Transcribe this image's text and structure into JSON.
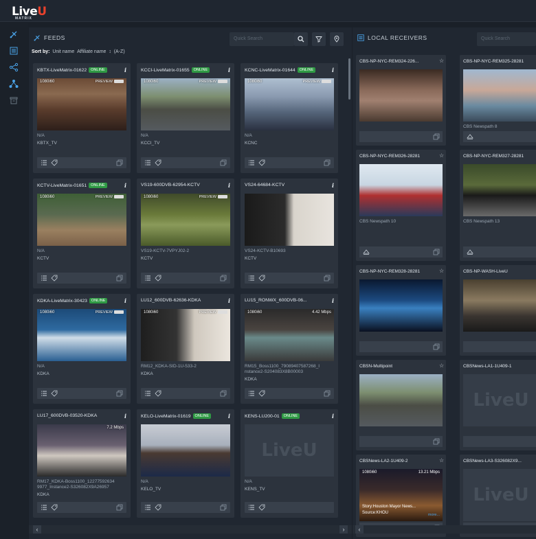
{
  "app": {
    "logo_main": "Live",
    "logo_accent": "U",
    "logo_sub": "MATRIX"
  },
  "nav": {
    "icons": [
      "satellite-icon",
      "list-icon",
      "share-icon",
      "network-icon",
      "archive-icon"
    ]
  },
  "feeds": {
    "title": "FEEDS",
    "search_placeholder": "Quick Search",
    "sort_label": "Sort by:",
    "sort_options": [
      "Unit name",
      "Affiliate name"
    ],
    "sort_order": "(A-Z)",
    "cards": [
      {
        "title": "KBTX-LiveMatrix-01622",
        "online": "ONLINE",
        "res": "1080i60",
        "preview": "PREVIEW",
        "line1": "N/A",
        "line2": "KBTX_TV",
        "scene": "interview"
      },
      {
        "title": "KCCI-LiveMatrix-01655",
        "online": "ONLINE",
        "res": "1080i60",
        "preview": "PREVIEW",
        "line1": "N/A",
        "line2": "KCCI_TV",
        "scene": "cycling"
      },
      {
        "title": "KCNC-LiveMatrix-01644",
        "online": "ONLINE",
        "res": "1080i60",
        "preview": "PREVIEW",
        "line1": "N/A",
        "line2": "KCNC",
        "scene": "snow"
      },
      {
        "title": "KCTV-LiveMatrix-01651",
        "online": "ONLINE",
        "res": "1080i60",
        "preview": "PREVIEW",
        "line1": "N/A",
        "line2": "KCTV",
        "scene": "baseball"
      },
      {
        "title": "VS19-600DVB-62954-KCTV",
        "online": "",
        "res": "1080i60",
        "preview": "PREVIEW",
        "line1": "VS19-KCTV-7VPYJ02-2",
        "line2": "KCTV",
        "scene": "helicopter"
      },
      {
        "title": "VS24-64684-KCTV",
        "online": "",
        "res": "",
        "preview": "",
        "line1": "VS24-KCTV-B10693",
        "line2": "KCTV",
        "scene": "wedding"
      },
      {
        "title": "KDKA-LiveMatrix-30423",
        "online": "ONLINE",
        "res": "1080i60",
        "preview": "PREVIEW",
        "line1": "N/A",
        "line2": "KDKA",
        "scene": "surf"
      },
      {
        "title": "LU12_600DVB-62636-KDKA",
        "online": "",
        "res": "1080i60",
        "preview": "PREVIEW",
        "line1": "RM12_KDKA-SID-1U-533-2",
        "line2": "KDKA",
        "scene": "wedding2"
      },
      {
        "title": "LU15_RONWX_600DVB-06...",
        "online": "",
        "res": "1080i60",
        "mbps": "4.42 Mbps",
        "line1": "RM15_Boss1100_79089407587268_I",
        "line1b": "nstance2-S204083X8B00003",
        "line2": "KDKA",
        "scene": "screens"
      },
      {
        "title": "LU17_600DVB-03520-KDKA",
        "online": "",
        "res": "",
        "mbps": "7.2 Mbps",
        "line1": "RM17_KDKA-Boss1100_12277592634",
        "line1b": "9977_Instance2-S326082X9A26957",
        "line2": "KDKA",
        "scene": "press"
      },
      {
        "title": "KELO-LiveMatrix-01619",
        "online": "ONLINE",
        "res": "",
        "preview": "",
        "line1": "N/A",
        "line2": "KELO_TV",
        "scene": "anchor"
      },
      {
        "title": "KENS-LU200-01",
        "online": "ONLINE",
        "res": "",
        "preview": "",
        "line1": "N/A",
        "line2": "KENS_TV",
        "scene": "placeholder"
      }
    ]
  },
  "receivers": {
    "title": "LOCAL RECEIVERS",
    "search_placeholder": "Quick Search",
    "cards": [
      {
        "title": "CBS-NP-NYC-REM324-226...",
        "caption": "",
        "scene": "crowd"
      },
      {
        "title": "CBS-NP-NYC-REM325-28281",
        "caption": "CBS Newspath 8",
        "scene": "fans"
      },
      {
        "title": "CBS-NP-NYC-REM326-28281",
        "caption": "CBS Newspath 10",
        "scene": "ski"
      },
      {
        "title": "CBS-NP-NYC-REM327-28281",
        "caption": "CBS Newspath 13",
        "scene": "racecar"
      },
      {
        "title": "CBS-NP-NYC-REM328-28281",
        "caption": "",
        "scene": "concert"
      },
      {
        "title": "CBS-NP-WASH-LiveU",
        "caption": "",
        "scene": "media"
      },
      {
        "title": "CBSN-Multipoint",
        "caption": "",
        "scene": "cycling"
      },
      {
        "title": "CBSNews-LA1-1U409-1",
        "caption": "",
        "scene": "placeholder"
      },
      {
        "title": "CBSNews-LA2-1U409-2",
        "caption": "",
        "scene": "city",
        "res": "1080i60",
        "mbps": "13.21 Mbps",
        "story": "Story:Houston Mayor News...",
        "source": "Source:KHOU",
        "more": "more..."
      },
      {
        "title": "CBSNews-LA3-S326082X9...",
        "caption": "",
        "scene": "placeholder"
      }
    ]
  },
  "placeholder_logo": "LiveU",
  "colors": {
    "online": "#2f9a44",
    "accent": "#e8412c",
    "bg": "#1a2028",
    "card": "#2c333d"
  }
}
